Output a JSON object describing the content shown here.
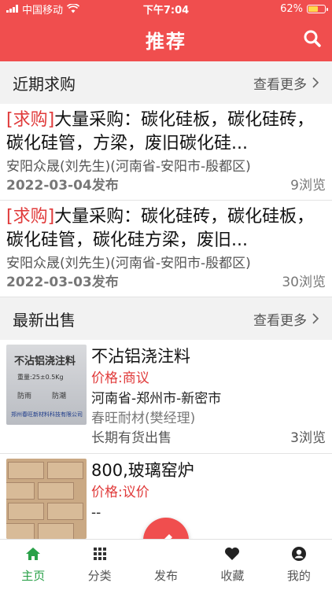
{
  "status": {
    "carrier": "中国移动",
    "time": "下午7:04",
    "battery": "62%",
    "battery_level": 0.62
  },
  "nav": {
    "title": "推荐",
    "search_icon": "search-icon"
  },
  "purchase": {
    "heading": "近期求购",
    "more": "查看更多",
    "items": [
      {
        "tag": "[求购]",
        "title": "大量采购：碳化硅板，碳化硅砖，碳化硅管，方梁，废旧碳化硅...",
        "company": "安阳众晟(刘先生)(河南省-安阳市-殷都区)",
        "date": "2022-03-04发布",
        "views": "9浏览"
      },
      {
        "tag": "[求购]",
        "title": "大量采购：碳化硅砖，碳化硅板，碳化硅管，碳化硅方梁，废旧...",
        "company": "安阳众晟(刘先生)(河南省-安阳市-殷都区)",
        "date": "2022-03-03发布",
        "views": "30浏览"
      }
    ]
  },
  "selling": {
    "heading": "最新出售",
    "more": "查看更多",
    "items": [
      {
        "name": "不沾铝浇注料",
        "price": "价格:商议",
        "location": "河南省-郑州市-新密市",
        "company": "春旺耐材(樊经理)",
        "status": "长期有货出售",
        "views": "3浏览",
        "thumb_text": "不沾铝浇注料",
        "thumb_weight": "重量:25±0.5Kg",
        "thumb_left": "防雨",
        "thumb_right": "防潮",
        "thumb_maker": "郑州春旺新材料科技有限公司"
      },
      {
        "name": "800,玻璃窑炉",
        "price": "价格:议价",
        "location": "--"
      }
    ]
  },
  "tabbar": {
    "tabs": [
      "主页",
      "分类",
      "发布",
      "收藏",
      "我的"
    ],
    "active_color": "#2aa149"
  },
  "colors": {
    "brand": "#f04e4e",
    "accent_text": "#e03a3a"
  }
}
